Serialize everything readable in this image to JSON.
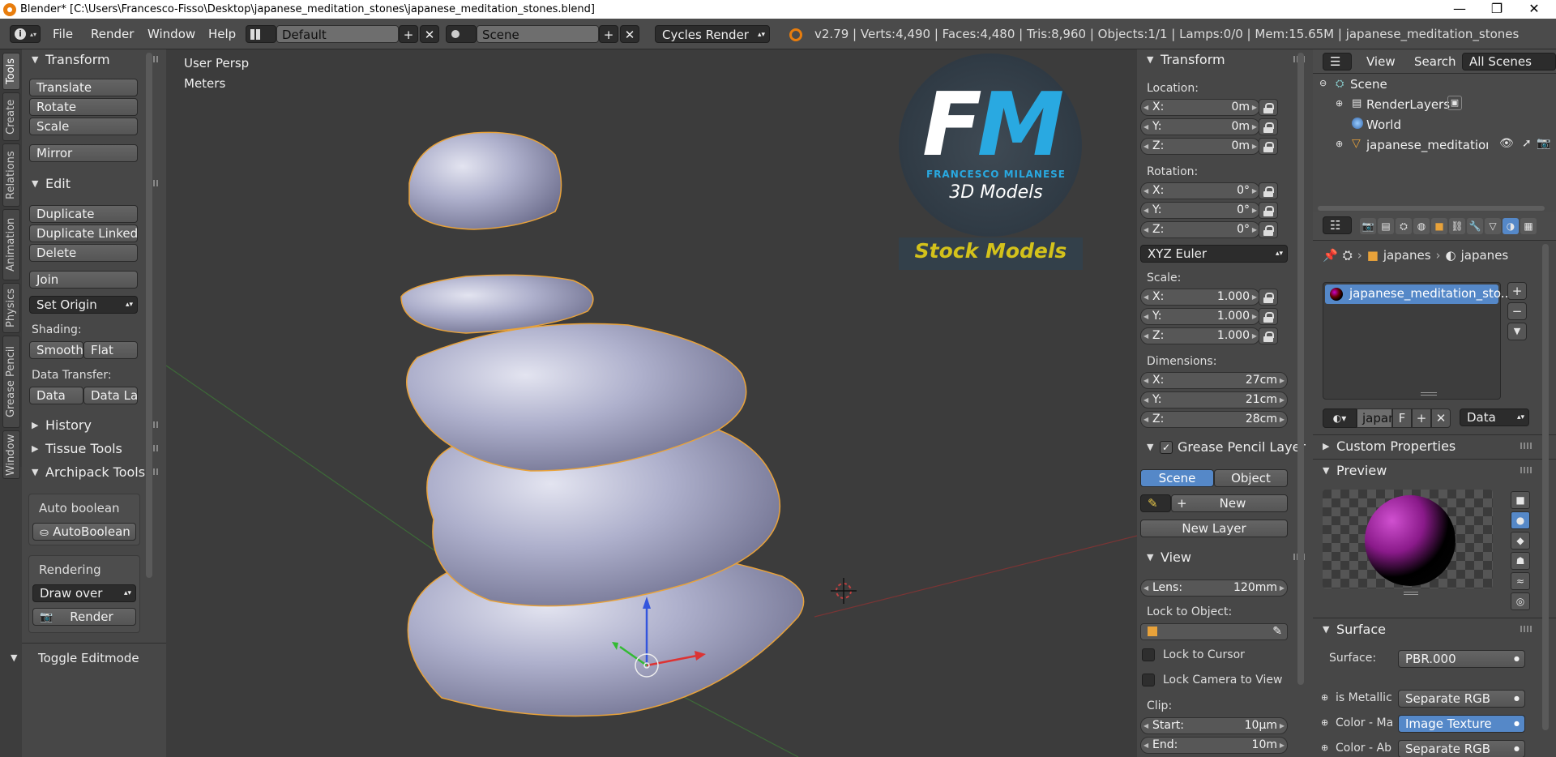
{
  "window": {
    "title": "Blender* [C:\\Users\\Francesco-Fisso\\Desktop\\japanese_meditation_stones\\japanese_meditation_stones.blend]",
    "controls": [
      "—",
      "❐",
      "✕"
    ]
  },
  "topbar": {
    "menus": [
      "File",
      "Render",
      "Window",
      "Help"
    ],
    "layout": "Default",
    "scene": "Scene",
    "engine": "Cycles Render",
    "stats": "v2.79 | Verts:4,490 | Faces:4,480 | Tris:8,960 | Objects:1/1 | Lamps:0/0 | Mem:15.65M | japanese_meditation_stones"
  },
  "tool_tabs": [
    "Tools",
    "Create",
    "Relations",
    "Animation",
    "Physics",
    "Grease Pencil",
    "Window"
  ],
  "tool_shelf": {
    "transform": {
      "title": "Transform",
      "buttons": [
        "Translate",
        "Rotate",
        "Scale",
        "Mirror"
      ]
    },
    "edit": {
      "title": "Edit",
      "buttons": [
        "Duplicate",
        "Duplicate Linked",
        "Delete",
        "Join"
      ],
      "set_origin": "Set Origin"
    },
    "shading": {
      "label": "Shading:",
      "smooth": "Smooth",
      "flat": "Flat"
    },
    "data_transfer": {
      "label": "Data Transfer:",
      "data": "Data",
      "data_la": "Data La"
    },
    "collapsed": [
      "History",
      "Tissue Tools"
    ],
    "archipack": {
      "title": "Archipack Tools",
      "auto_boolean": "Auto boolean",
      "autoboolean_btn": "AutoBoolean",
      "rendering": "Rendering",
      "draw_over": "Draw over",
      "render_btn": "Render"
    },
    "toggle_editmode": "Toggle Editmode"
  },
  "viewport": {
    "view_name": "User Persp",
    "units": "Meters",
    "logo": {
      "letters": "FM",
      "name": "FRANCESCO MILANESE",
      "sub": "3D Models",
      "stock": "Stock Models"
    }
  },
  "properties_n": {
    "transform_title": "Transform",
    "location": {
      "label": "Location:",
      "x": "0m",
      "y": "0m",
      "z": "0m"
    },
    "rotation": {
      "label": "Rotation:",
      "x": "0°",
      "y": "0°",
      "z": "0°"
    },
    "rotation_mode": "XYZ Euler",
    "scale": {
      "label": "Scale:",
      "x": "1.000",
      "y": "1.000",
      "z": "1.000"
    },
    "dimensions": {
      "label": "Dimensions:",
      "x": "27cm",
      "y": "21cm",
      "z": "28cm"
    },
    "axis": {
      "x": "X:",
      "y": "Y:",
      "z": "Z:"
    },
    "grease_pencil": {
      "title": "Grease Pencil Layer",
      "scene": "Scene",
      "object": "Object",
      "new": "New",
      "new_layer": "New Layer"
    },
    "view": {
      "title": "View",
      "lens_label": "Lens:",
      "lens": "120mm",
      "lock_label": "Lock to Object:",
      "lock_cursor": "Lock to Cursor",
      "lock_camera": "Lock Camera to View",
      "clip_label": "Clip:",
      "start_label": "Start:",
      "start": "10µm",
      "end_label": "End:",
      "end": "10m"
    }
  },
  "outliner": {
    "menus": [
      "View",
      "Search"
    ],
    "filter": "All Scenes",
    "items": [
      "Scene",
      "RenderLayers",
      "World",
      "japanese_meditation_s"
    ]
  },
  "material_props": {
    "breadcrumbs": [
      "japanes",
      "japanes"
    ],
    "slot": "japanese_meditation_sto...",
    "datablock": {
      "name": "japan",
      "users": "F",
      "link": "Data"
    },
    "sections": [
      "Custom Properties",
      "Preview",
      "Surface"
    ],
    "surface_label": "Surface:",
    "surface_value": "PBR.000",
    "inputs": [
      {
        "name": "is Metallic",
        "value": "Separate RGB"
      },
      {
        "name": "Color - Ma",
        "value": "Image Texture"
      },
      {
        "name": "Color - Ab",
        "value": "Separate RGB"
      }
    ]
  },
  "colors": {
    "accent": "#5588c8",
    "selection_outline": "#e8a23a",
    "stone": "#a8a9c8",
    "logo_blue": "#29a9e1",
    "logo_stock": "#d4c21b"
  }
}
